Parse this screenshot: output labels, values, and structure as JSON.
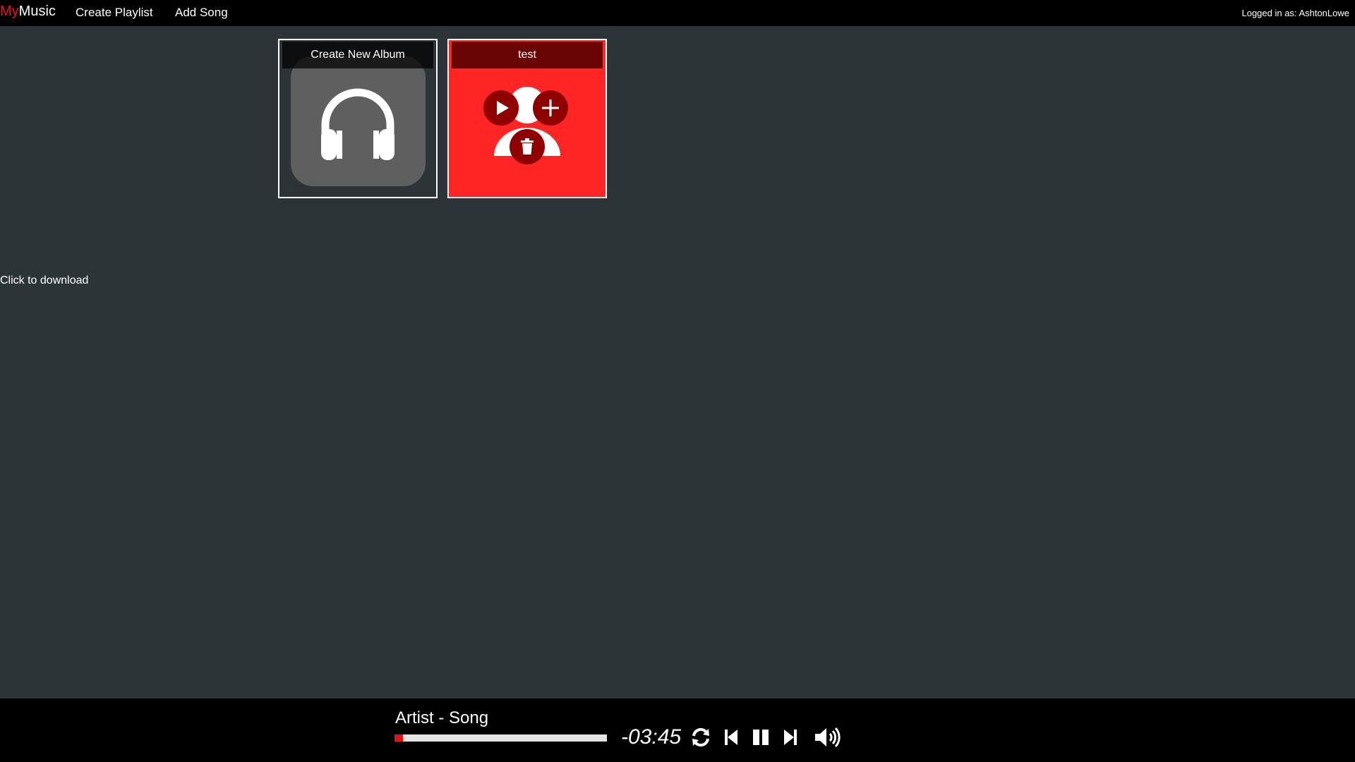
{
  "navbar": {
    "brand_prefix": "My",
    "brand_suffix": "Music",
    "links": [
      "Create Playlist",
      "Add Song"
    ],
    "login_label": "Logged in as: AshtonLowe"
  },
  "albums": [
    {
      "title": "Create New Album",
      "icon": "headphones-icon"
    },
    {
      "title": "test",
      "icon": "people-icon",
      "actions": [
        "play-icon",
        "plus-icon",
        "trash-icon"
      ]
    }
  ],
  "download_text": "Click to download",
  "player": {
    "track": "Artist - Song",
    "time_remaining": "-03:45",
    "progress_fraction": 0.04,
    "controls": [
      "repeat-icon",
      "skip-back-icon",
      "pause-icon",
      "skip-forward-icon",
      "volume-icon"
    ]
  },
  "colors": {
    "background": "#2d3437",
    "bar": "#000000",
    "accent": "#e8111a",
    "album_red": "#ff2525",
    "button_dark_red": "#8f0000",
    "headphone_tile": "#5f5f5f"
  }
}
